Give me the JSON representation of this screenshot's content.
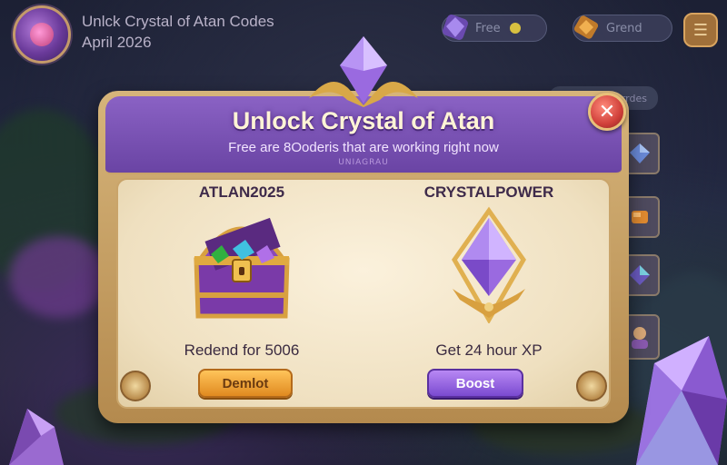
{
  "hud": {
    "title_line1": "Unlck Crystal of Atan Codes",
    "title_line2": "April 2026",
    "currency_1_label": "Free",
    "currency_2_label": "Grend",
    "menu_icon": "hamburger-menu-icon"
  },
  "side": {
    "strip_label": "Prrdes"
  },
  "dialog": {
    "title": "Unlock Crystal of Atan",
    "subtitle": "Free are 8Ooderis that are working right now",
    "tag": "UNIAGRAU",
    "close_icon": "close-icon"
  },
  "codes": [
    {
      "code": "ATLAN2025",
      "reward": "Redend for 5006",
      "button_label": "Demlot",
      "icon": "treasure-chest-icon",
      "button_color": "#f0a030"
    },
    {
      "code": "CRYSTALPOWER",
      "reward": "Get 24 hour XP",
      "button_label": "Boost",
      "icon": "purple-crystal-icon",
      "button_color": "#9a66e4"
    }
  ],
  "colors": {
    "header_purple": "#7a52b4",
    "frame_gold": "#c9a46a",
    "body_cream": "#f5e8cc"
  }
}
